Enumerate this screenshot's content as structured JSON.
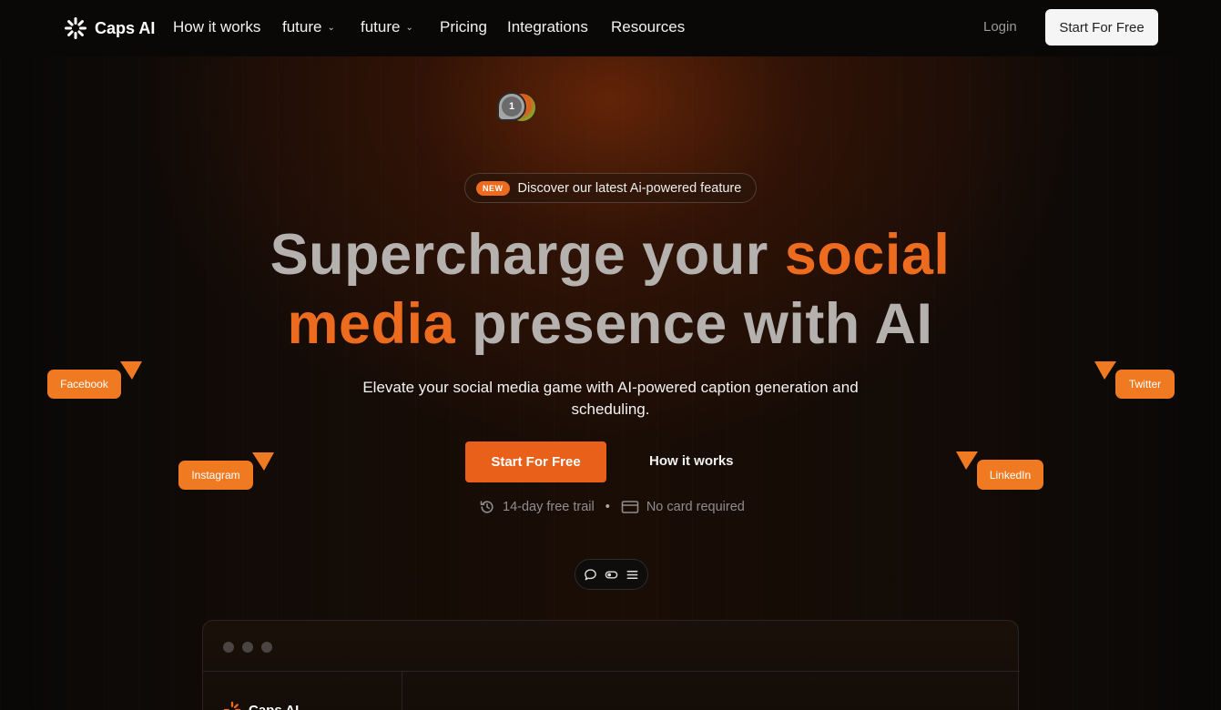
{
  "nav": {
    "brand": "Caps AI",
    "links": [
      {
        "label": "How it works"
      },
      {
        "label": "future"
      },
      {
        "label": "future"
      },
      {
        "label": "Pricing"
      },
      {
        "label": "Integrations"
      },
      {
        "label": "Resources"
      }
    ],
    "login": "Login",
    "cta": "Start For Free"
  },
  "avatars": {
    "count_label": "1"
  },
  "announcement": {
    "badge": "NEW",
    "text": "Discover our latest Ai-powered feature"
  },
  "hero": {
    "headline_part1": "Supercharge your",
    "headline_accent1": "social",
    "headline_accent2": "media",
    "headline_part2": "presence with AI",
    "subtitle": "Elevate your social media game with AI-powered caption generation and scheduling.",
    "cta_primary": "Start For Free",
    "cta_secondary": "How it works",
    "meta_trial": "14-day free trail",
    "meta_card": "No card required"
  },
  "floating_tags": {
    "facebook": "Facebook",
    "instagram": "Instagram",
    "twitter": "Twitter",
    "linkedin": "LinkedIn"
  },
  "toolbar": {
    "icons": [
      "chat-bubble-icon",
      "toggle-icon",
      "menu-icon"
    ]
  },
  "preview_panel": {
    "brand": "Caps AI"
  },
  "colors": {
    "accent": "#ec6b1e",
    "tag_bg": "#f07a22",
    "background": "#0b0908"
  }
}
